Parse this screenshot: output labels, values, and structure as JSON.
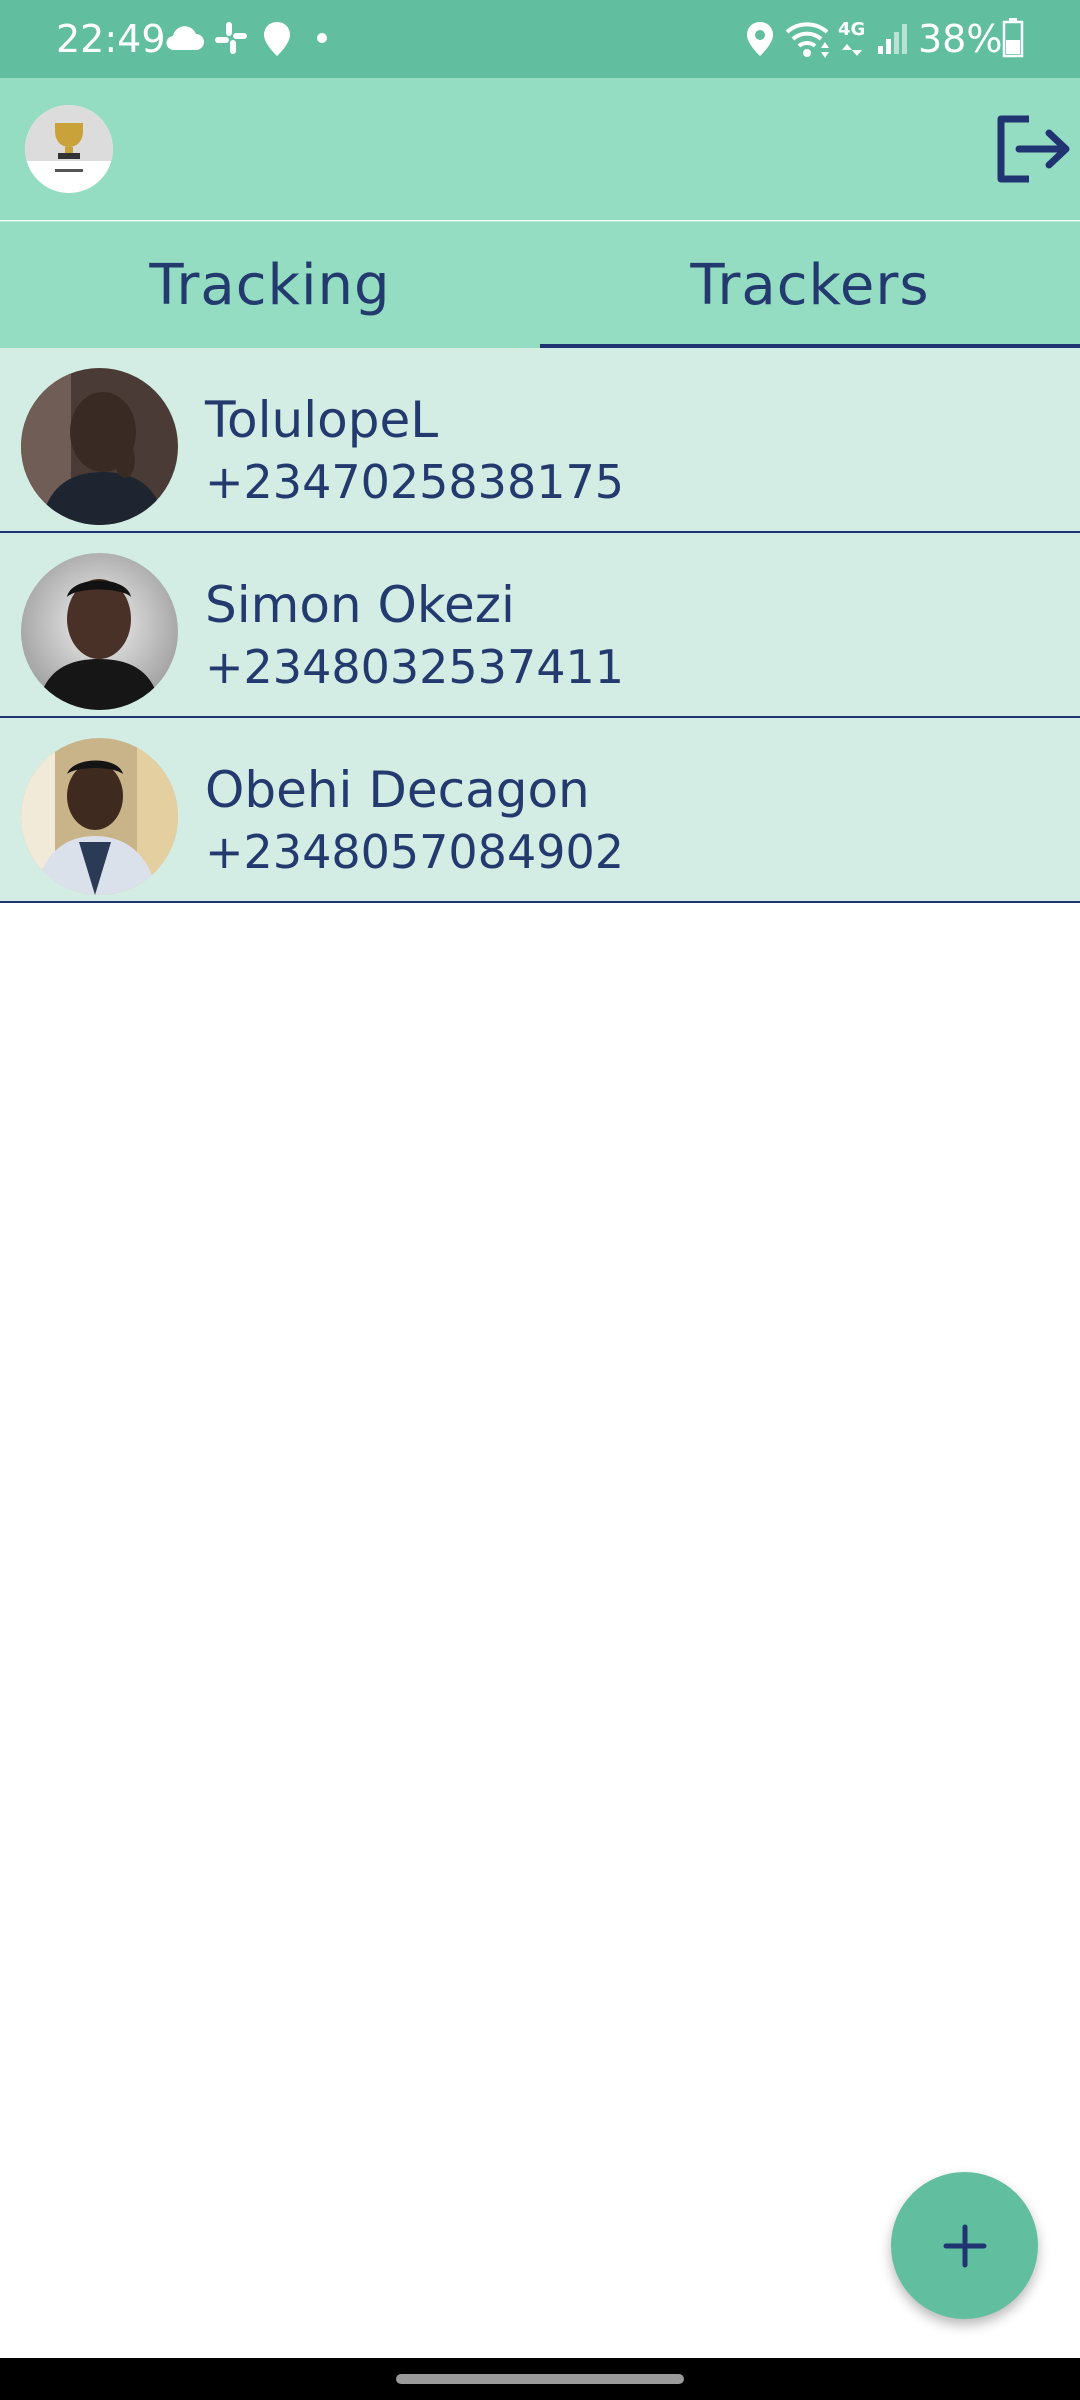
{
  "status_bar": {
    "time": "22:49",
    "battery": "38%",
    "network": "4G",
    "icons": [
      "cloud-icon",
      "slack-icon",
      "map-pin-icon",
      "dot-icon",
      "location-icon",
      "wifi-icon",
      "signal-icon",
      "battery-icon"
    ]
  },
  "app_bar": {
    "avatar_icon": "profile-trophy-avatar",
    "logout_icon": "logout-icon"
  },
  "tabs": {
    "items": [
      {
        "label": "Tracking",
        "selected": false
      },
      {
        "label": "Trackers",
        "selected": true
      }
    ],
    "indicator_color": "#1f3470"
  },
  "trackers": [
    {
      "name": "TolulopeL",
      "phone": "+2347025838175",
      "avatar": "avatar-photo"
    },
    {
      "name": "Simon Okezi",
      "phone": "+2348032537411",
      "avatar": "avatar-photo"
    },
    {
      "name": "Obehi Decagon",
      "phone": "+2348057084902",
      "avatar": "avatar-photo"
    }
  ],
  "fab": {
    "icon": "plus-icon"
  },
  "colors": {
    "primary": "#61bf9f",
    "app_bar": "#94dcc2",
    "list_bg": "#d3ede4",
    "text": "#243a6e"
  }
}
